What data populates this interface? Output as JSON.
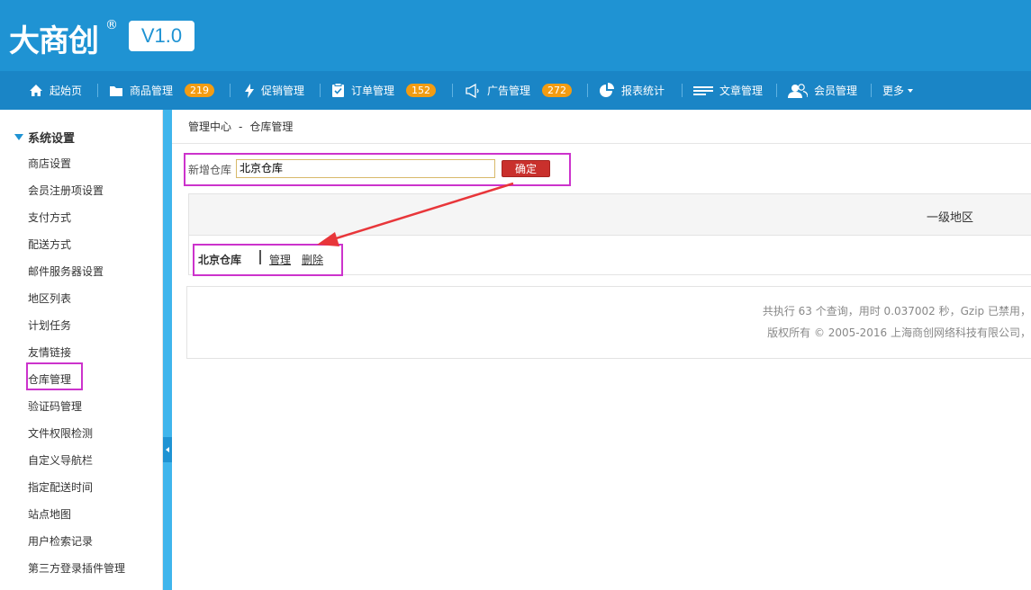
{
  "header": {
    "logo_text": "大商创",
    "logo_mark": "®",
    "version": "V1.0"
  },
  "nav": {
    "home": "起始页",
    "goods": "商品管理",
    "goods_badge": "219",
    "promo": "促销管理",
    "orders": "订单管理",
    "orders_badge": "152",
    "ads": "广告管理",
    "ads_badge": "272",
    "stats": "报表统计",
    "articles": "文章管理",
    "members": "会员管理",
    "more": "更多"
  },
  "sidebar": {
    "section_title": "系统设置",
    "items": [
      "商店设置",
      "会员注册项设置",
      "支付方式",
      "配送方式",
      "邮件服务器设置",
      "地区列表",
      "计划任务",
      "友情链接",
      "仓库管理",
      "验证码管理",
      "文件权限检测",
      "自定义导航栏",
      "指定配送时间",
      "站点地图",
      "用户检索记录",
      "第三方登录插件管理"
    ]
  },
  "breadcrumb": {
    "root": "管理中心",
    "separator": "-",
    "current": "仓库管理"
  },
  "add_form": {
    "label": "新增仓库",
    "input_value": "北京仓库",
    "submit_label": "确定"
  },
  "table": {
    "header_region": "一级地区",
    "rows": [
      {
        "name": "北京仓库",
        "manage": "管理",
        "delete": "删除"
      }
    ]
  },
  "footer": {
    "line1": "共执行 63 个查询，用时 0.037002 秒，Gzip 已禁用，",
    "line2": "版权所有 © 2005-2016 上海商创网络科技有限公司，"
  },
  "colors": {
    "header_bg": "#1f93d3",
    "nav_bg": "#1a85c6",
    "badge": "#f39c12",
    "confirm_button": "#c9302c",
    "highlight": "#cc33cc",
    "arrow": "#e8363a"
  }
}
